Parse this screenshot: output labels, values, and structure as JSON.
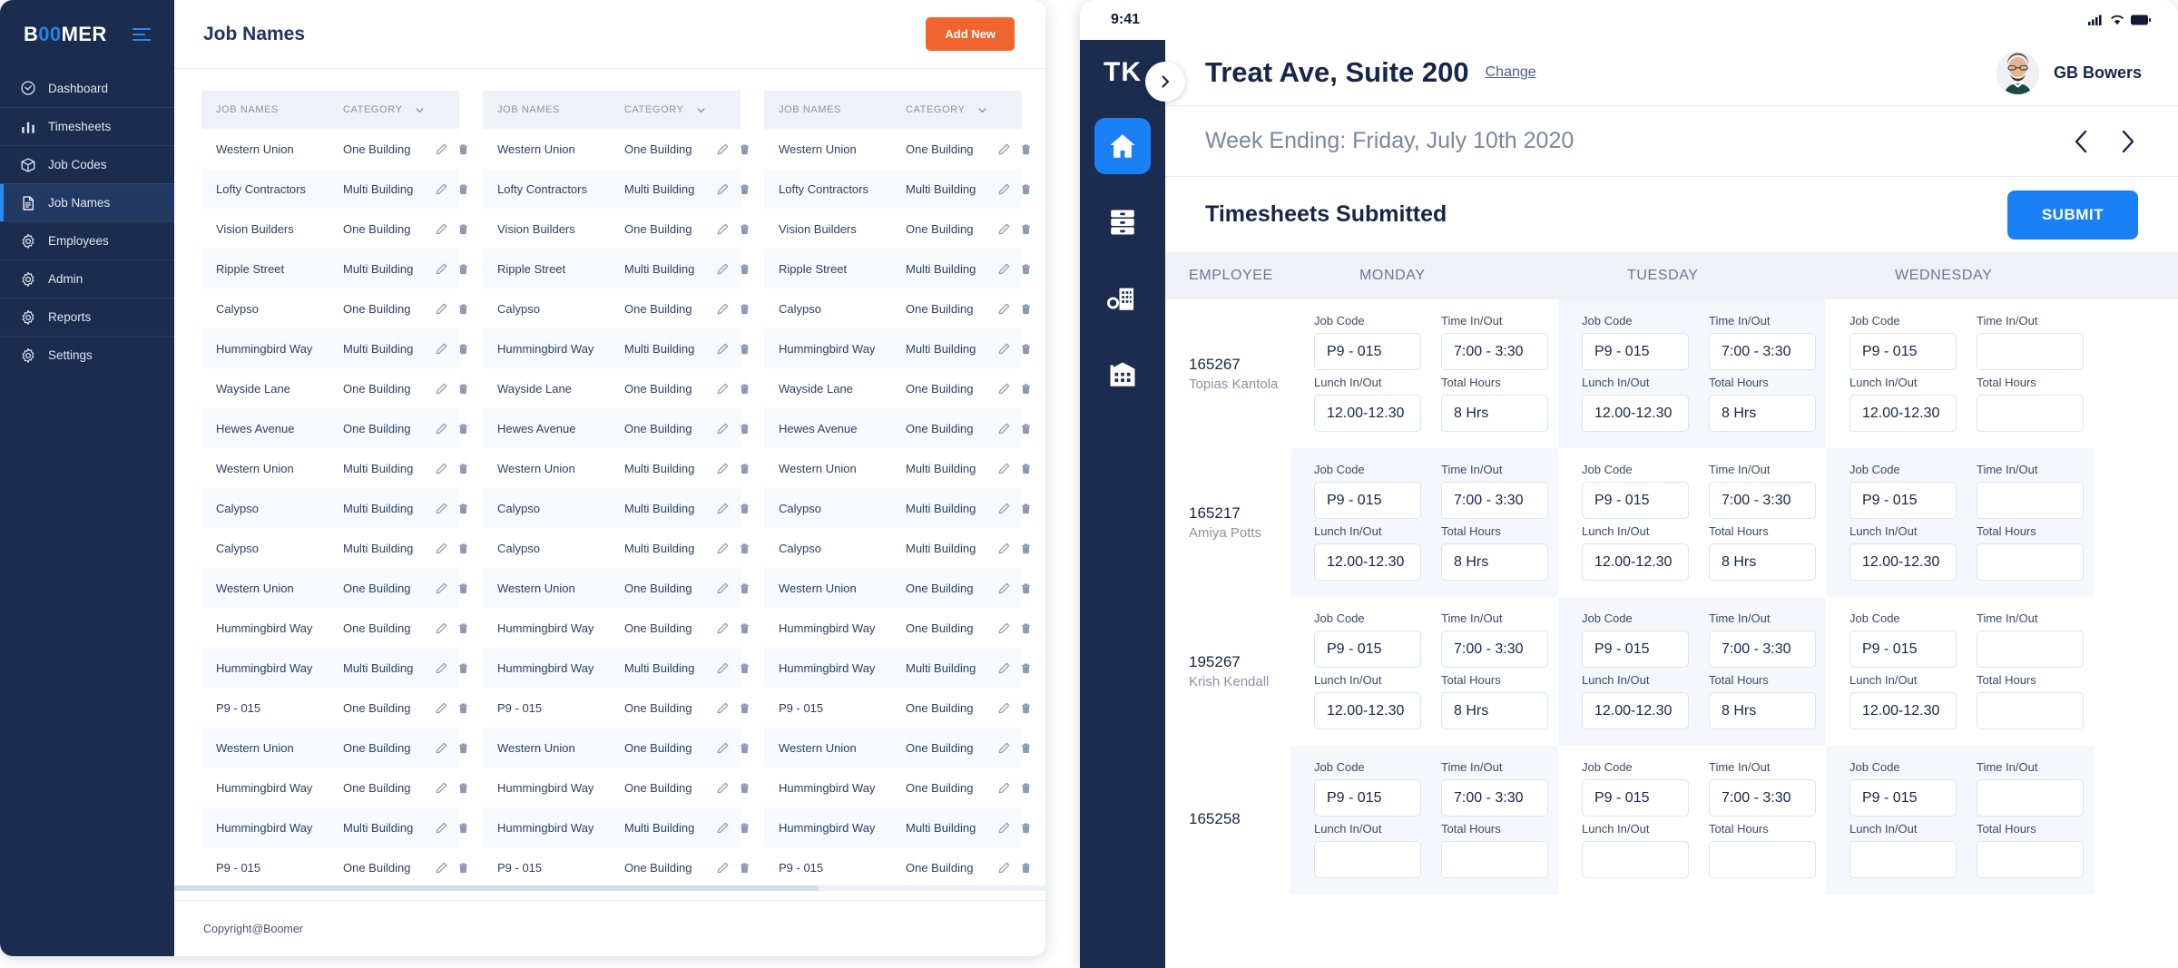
{
  "desktop": {
    "brand": {
      "prefix": "B",
      "accent": "00",
      "suffix": "MER"
    },
    "page_title": "Job Names",
    "add_button": "Add New",
    "footer": "Copyright@Boomer",
    "sidebar": [
      {
        "label": "Dashboard",
        "icon": "dashboard-icon"
      },
      {
        "label": "Timesheets",
        "icon": "chart-icon"
      },
      {
        "label": "Job Codes",
        "icon": "box-icon"
      },
      {
        "label": "Job Names",
        "icon": "document-icon"
      },
      {
        "label": "Employees",
        "icon": "gear-icon"
      },
      {
        "label": "Admin",
        "icon": "gear-icon"
      },
      {
        "label": "Reports",
        "icon": "gear-icon"
      },
      {
        "label": "Settings",
        "icon": "gear-icon"
      }
    ],
    "active_item": "Job Names",
    "table": {
      "headers": {
        "name": "JOB NAMES",
        "category": "CATEGORY"
      },
      "rows": [
        {
          "name": "Western Union",
          "category": "One Building"
        },
        {
          "name": "Lofty Contractors",
          "category": "Multi Building"
        },
        {
          "name": "Vision Builders",
          "category": "One Building"
        },
        {
          "name": "Ripple Street",
          "category": "Multi Building"
        },
        {
          "name": "Calypso",
          "category": "One Building"
        },
        {
          "name": "Hummingbird Way",
          "category": "Multi Building"
        },
        {
          "name": "Wayside Lane",
          "category": "One Building"
        },
        {
          "name": "Hewes Avenue",
          "category": "One Building"
        },
        {
          "name": "Western Union",
          "category": "Multi Building"
        },
        {
          "name": "Calypso",
          "category": "Multi Building"
        },
        {
          "name": "Calypso",
          "category": "Multi Building"
        },
        {
          "name": "Western Union",
          "category": "One Building"
        },
        {
          "name": "Hummingbird Way",
          "category": "One Building"
        },
        {
          "name": "Hummingbird Way",
          "category": "Multi Building"
        },
        {
          "name": "P9 - 015",
          "category": "One Building"
        },
        {
          "name": "Western Union",
          "category": "One Building"
        },
        {
          "name": "Hummingbird Way",
          "category": "One Building"
        },
        {
          "name": "Hummingbird Way",
          "category": "Multi Building"
        },
        {
          "name": "P9 - 015",
          "category": "One Building"
        }
      ]
    }
  },
  "tablet": {
    "status": {
      "time": "9:41"
    },
    "logo": "TK",
    "title": "Treat Ave, Suite 200",
    "change_link": "Change",
    "user_name": "GB Bowers",
    "week_ending": "Week Ending: Friday, July 10th 2020",
    "section_title": "Timesheets Submitted",
    "submit_button": "SUBMIT",
    "rail": [
      {
        "icon": "home-icon",
        "active": true
      },
      {
        "icon": "file-cabinet-icon",
        "active": false
      },
      {
        "icon": "building-pin-icon",
        "active": false
      },
      {
        "icon": "warehouse-icon",
        "active": false
      }
    ],
    "grid": {
      "headers": [
        "EMPLOYEE",
        "MONDAY",
        "TUESDAY",
        "WEDNESDAY"
      ],
      "field_labels": {
        "job_code": "Job Code",
        "time_in_out": "Time In/Out",
        "lunch_in_out": "Lunch In/Out",
        "total_hours": "Total Hours"
      },
      "employees": [
        {
          "id": "165267",
          "name": "Topias Kantola",
          "days": [
            {
              "job_code": "P9 - 015",
              "time_in_out": "7:00 - 3:30",
              "lunch_in_out": "12.00-12.30",
              "total_hours": "8 Hrs"
            },
            {
              "job_code": "P9 - 015",
              "time_in_out": "7:00 - 3:30",
              "lunch_in_out": "12.00-12.30",
              "total_hours": "8 Hrs"
            },
            {
              "job_code": "P9 - 015",
              "time_in_out": "",
              "lunch_in_out": "12.00-12.30",
              "total_hours": ""
            }
          ]
        },
        {
          "id": "165217",
          "name": "Amiya Potts",
          "days": [
            {
              "job_code": "P9 - 015",
              "time_in_out": "7:00 - 3:30",
              "lunch_in_out": "12.00-12.30",
              "total_hours": "8 Hrs"
            },
            {
              "job_code": "P9 - 015",
              "time_in_out": "7:00 - 3:30",
              "lunch_in_out": "12.00-12.30",
              "total_hours": "8 Hrs"
            },
            {
              "job_code": "P9 - 015",
              "time_in_out": "",
              "lunch_in_out": "12.00-12.30",
              "total_hours": ""
            }
          ]
        },
        {
          "id": "195267",
          "name": "Krish Kendall",
          "days": [
            {
              "job_code": "P9 - 015",
              "time_in_out": "7:00 - 3:30",
              "lunch_in_out": "12.00-12.30",
              "total_hours": "8 Hrs"
            },
            {
              "job_code": "P9 - 015",
              "time_in_out": "7:00 - 3:30",
              "lunch_in_out": "12.00-12.30",
              "total_hours": "8 Hrs"
            },
            {
              "job_code": "P9 - 015",
              "time_in_out": "",
              "lunch_in_out": "12.00-12.30",
              "total_hours": ""
            }
          ]
        },
        {
          "id": "165258",
          "name": "",
          "days": [
            {
              "job_code": "P9 - 015",
              "time_in_out": "7:00 - 3:30",
              "lunch_in_out": "",
              "total_hours": ""
            },
            {
              "job_code": "P9 - 015",
              "time_in_out": "7:00 - 3:30",
              "lunch_in_out": "",
              "total_hours": ""
            },
            {
              "job_code": "P9 - 015",
              "time_in_out": "",
              "lunch_in_out": "",
              "total_hours": ""
            }
          ]
        }
      ]
    }
  },
  "colors": {
    "navy": "#1b2c4f",
    "accent_blue": "#1a80f5",
    "orange": "#f0652f",
    "row_alt": "#f6f9fd"
  }
}
